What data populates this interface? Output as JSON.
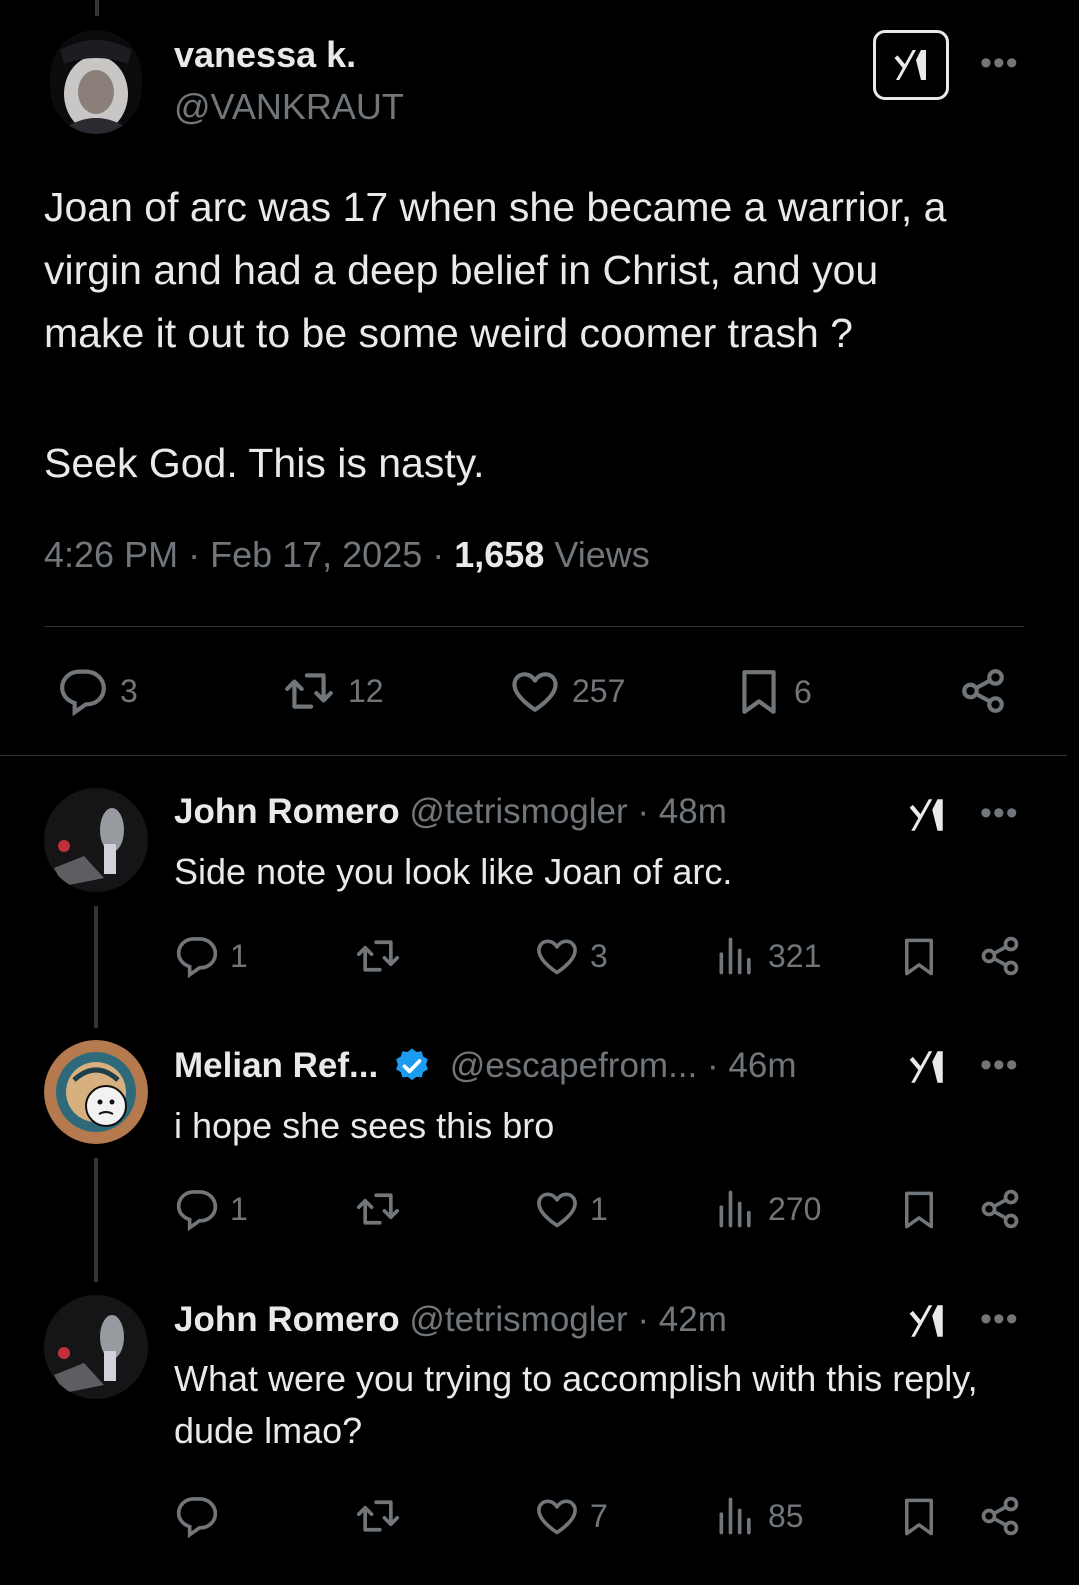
{
  "main": {
    "name": "vanessa k.",
    "handle": "@VANKRAUT",
    "text_lines": [
      "Joan of arc was 17 when she became a warrior, a",
      "virgin and had a deep belief in Christ, and you",
      "make it out to be some weird coomer trash ?",
      "",
      "Seek God. This is nasty."
    ],
    "time": "4:26 PM",
    "date": "Feb 17, 2025",
    "views_count": "1,658",
    "views_label": "Views",
    "actions": {
      "replies": "3",
      "reposts": "12",
      "likes": "257",
      "bookmarks": "6"
    }
  },
  "replies": [
    {
      "name": "John Romero",
      "handle": "@tetrismogler",
      "time": "48m",
      "text": "Side note you look like Joan of arc.",
      "replies": "1",
      "reposts": "",
      "likes": "3",
      "views": "321"
    },
    {
      "name": "Melian Ref...",
      "handle": "@escapefrom...",
      "time": "46m",
      "text": "i hope she sees this bro",
      "replies": "1",
      "reposts": "",
      "likes": "1",
      "views": "270"
    },
    {
      "name": "John Romero",
      "handle": "@tetrismogler",
      "time": "42m",
      "text": "What were you trying to accomplish with this reply, dude lmao?",
      "replies": "",
      "reposts": "",
      "likes": "7",
      "views": "85"
    }
  ],
  "colors": {
    "background": "#000000",
    "text": "#e7e9ea",
    "muted": "#71767b",
    "verified": "#1d9bf0",
    "divider": "#2f3336"
  },
  "icons": [
    "grok-icon",
    "more-icon",
    "reply-icon",
    "repost-icon",
    "like-icon",
    "bookmark-icon",
    "share-icon",
    "views-icon",
    "verified-badge-icon"
  ]
}
